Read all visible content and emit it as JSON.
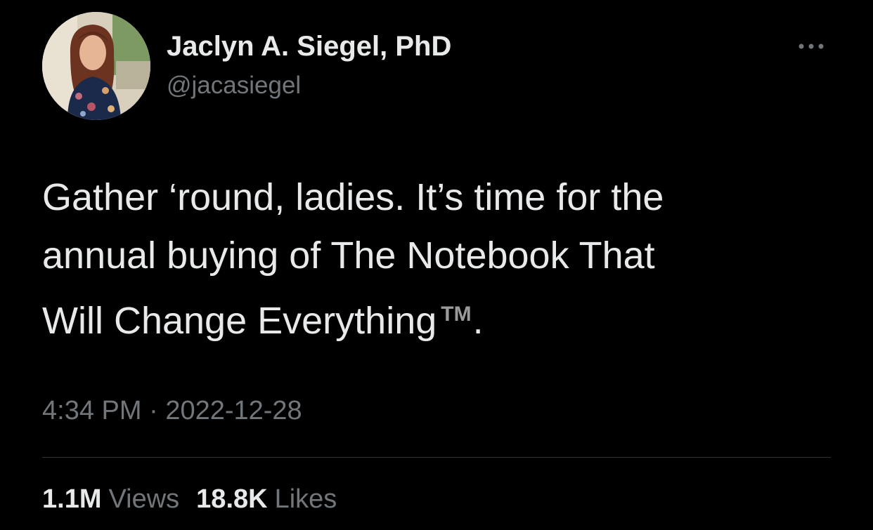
{
  "author": {
    "display_name": "Jaclyn A. Siegel, PhD",
    "handle": "@jacasiegel",
    "avatar_icon": "profile-photo"
  },
  "menu_icon": "more-horizontal-icon",
  "tweet": {
    "lines": [
      "Gather ‘round, ladies. It’s time for the",
      "annual buying of The Notebook That",
      "Will Change Everything"
    ],
    "trademark": "TM",
    "final_punct": ".",
    "time": "4:34 PM",
    "separator": "·",
    "date": "2022-12-28"
  },
  "stats": {
    "views_value": "1.1M",
    "views_label": "Views",
    "likes_value": "18.8K",
    "likes_label": "Likes"
  },
  "colors": {
    "background": "#000000",
    "primary_text": "#e7e9ea",
    "secondary_text": "#71767b",
    "divider": "#2f3336"
  }
}
